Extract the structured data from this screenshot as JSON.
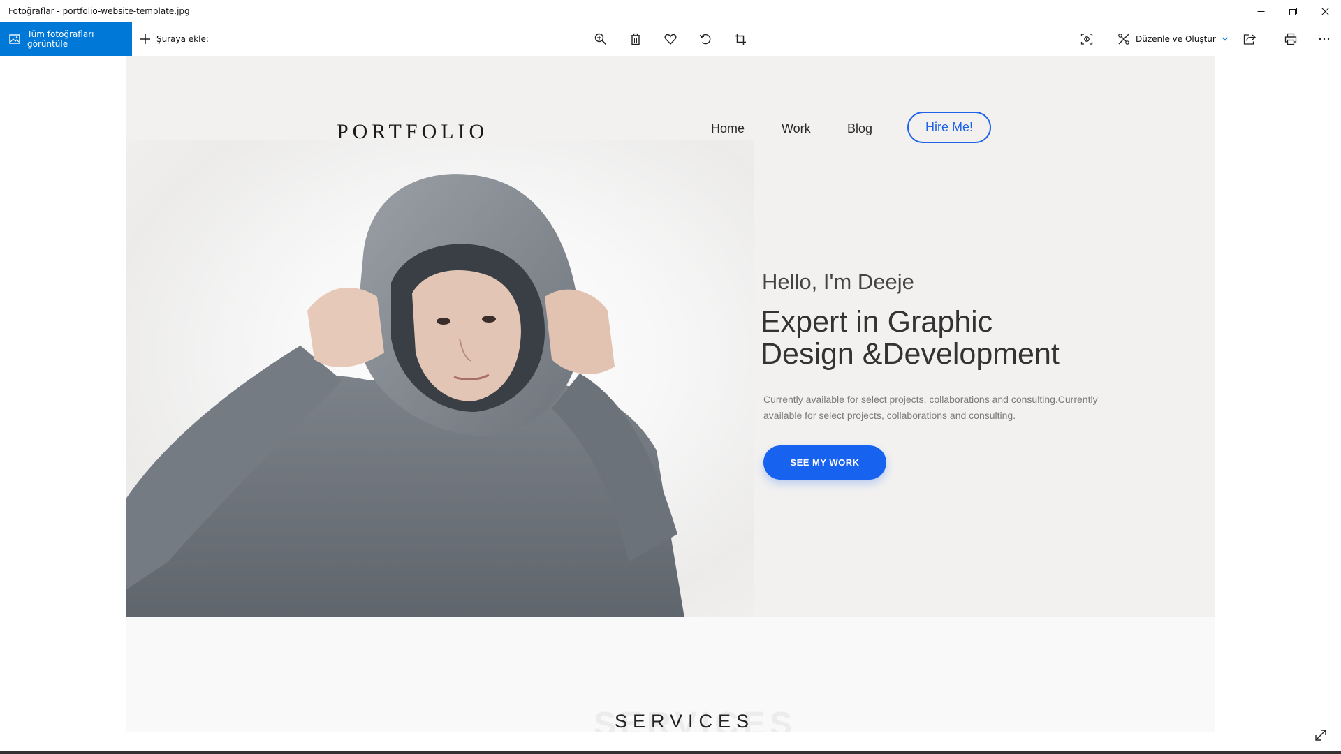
{
  "window": {
    "title": "Fotoğraflar - portfolio-website-template.jpg"
  },
  "toolbar": {
    "all_photos_label": "Tüm fotoğrafları görüntüle",
    "add_to_label": "Şuraya ekle:",
    "edit_create_label": "Düzenle ve Oluştur",
    "icons": [
      "zoom-in-icon",
      "delete-icon",
      "favorite-icon",
      "rotate-icon",
      "crop-icon",
      "enhance-icon",
      "share-icon",
      "print-icon",
      "more-icon"
    ]
  },
  "photo": {
    "logo": "PORTFOLIO",
    "nav": [
      "Home",
      "Work",
      "Blog"
    ],
    "hire_label": "Hire Me!",
    "hello": "Hello, I'm Deeje",
    "headline_line1": "Expert in Graphic",
    "headline_line2": "Design &Development",
    "description": "Currently available for select projects, collaborations and consulting.Currently available for select projects, collaborations and consulting.",
    "cta_label": "SEE MY WORK",
    "services_heading": "SERVICES"
  },
  "colors": {
    "accent": "#0078d7",
    "brand_blue": "#1862f0",
    "hero_bg": "#f2f1f0"
  }
}
